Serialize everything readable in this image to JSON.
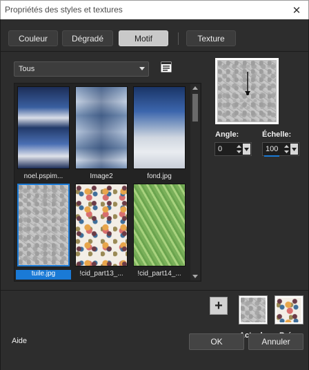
{
  "window": {
    "title": "Propriétés des styles et textures"
  },
  "tabs": [
    {
      "label": "Couleur",
      "active": false
    },
    {
      "label": "Dégradé",
      "active": false
    },
    {
      "label": "Motif",
      "active": true
    },
    {
      "label": "Texture",
      "active": false
    }
  ],
  "category_select": {
    "value": "Tous"
  },
  "thumbnails": [
    {
      "label": "noel.pspim...",
      "selected": false
    },
    {
      "label": "Image2",
      "selected": false
    },
    {
      "label": "fond.jpg",
      "selected": false
    },
    {
      "label": "tuile.jpg",
      "selected": true
    },
    {
      "label": "!cid_part13_...",
      "selected": false
    },
    {
      "label": "!cid_part14_...",
      "selected": false
    }
  ],
  "angle": {
    "label": "Angle:",
    "value": "0"
  },
  "scale": {
    "label": "Échelle:",
    "value": "100"
  },
  "swatches": {
    "current_label": "Actuel",
    "previous_label": "Préc."
  },
  "footer": {
    "help_label": "Aide",
    "ok_label": "OK",
    "cancel_label": "Annuler"
  },
  "colors": {
    "accent": "#1a7ad6",
    "background": "#2d2d2d"
  }
}
